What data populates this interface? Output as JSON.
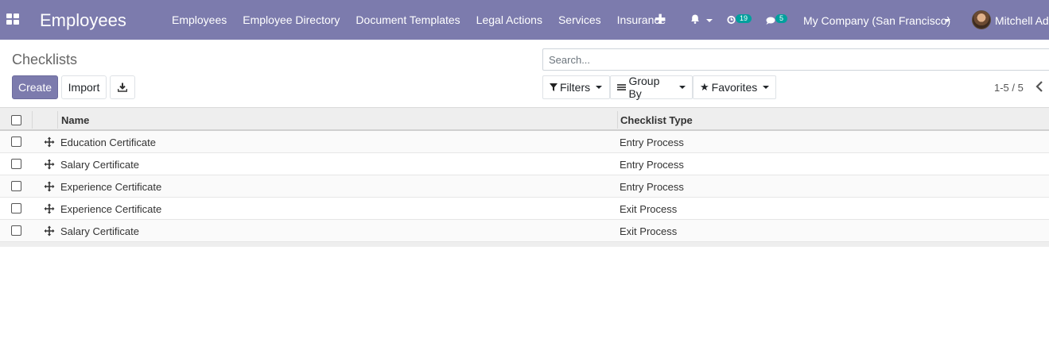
{
  "navbar": {
    "app_name": "Employees",
    "menu": [
      "Employees",
      "Employee Directory",
      "Document Templates",
      "Legal Actions",
      "Services",
      "Insurance"
    ],
    "add_icon": "plus-icon",
    "activity_badge": "19",
    "messages_badge": "5",
    "company": "My Company (San Francisco)",
    "user": "Mitchell Admin",
    "accent_color": "#7c7bad"
  },
  "control_panel": {
    "breadcrumb": "Checklists",
    "create_label": "Create",
    "import_label": "Import",
    "search_placeholder": "Search...",
    "filters_label": "Filters",
    "groupby_label": "Group By",
    "favorites_label": "Favorites",
    "pager": "1-5 / 5"
  },
  "table": {
    "columns": [
      "Name",
      "Checklist Type"
    ],
    "rows": [
      {
        "name": "Education Certificate",
        "type": "Entry Process"
      },
      {
        "name": "Salary Certificate",
        "type": "Entry Process"
      },
      {
        "name": "Experience Certificate",
        "type": "Entry Process"
      },
      {
        "name": "Experience Certificate",
        "type": "Exit Process"
      },
      {
        "name": "Salary Certificate",
        "type": "Exit Process"
      }
    ]
  }
}
